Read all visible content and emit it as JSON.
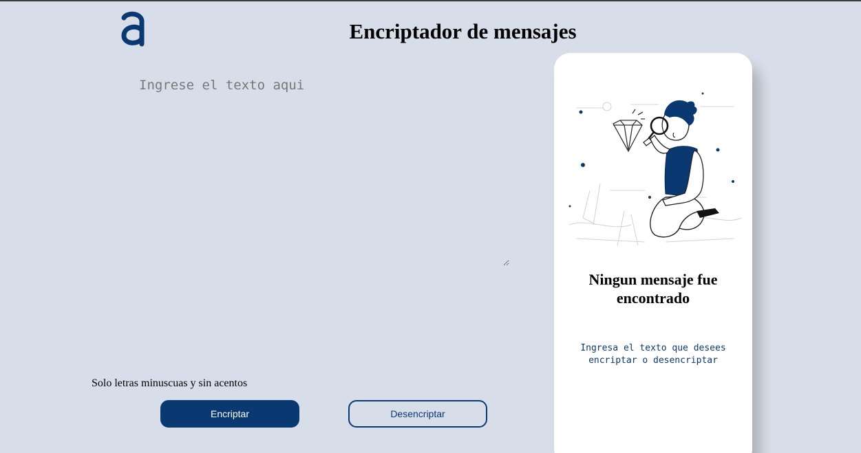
{
  "header": {
    "title": "Encriptador de mensajes",
    "logo_icon": "alura-logo-icon"
  },
  "editor": {
    "placeholder": "Ingrese el texto aqui",
    "value": ""
  },
  "footer": {
    "hint": "Solo letras minuscuas y sin acentos",
    "encrypt_label": "Encriptar",
    "decrypt_label": "Desencriptar"
  },
  "result": {
    "illustration_icon": "boy-magnifying-glass-illustration",
    "title": "Ningun mensaje fue encontrado",
    "text": "Ingresa el texto que desees encriptar o desencriptar"
  },
  "colors": {
    "background": "#d8dee9",
    "primary": "#0a3871",
    "card": "#ffffff"
  }
}
